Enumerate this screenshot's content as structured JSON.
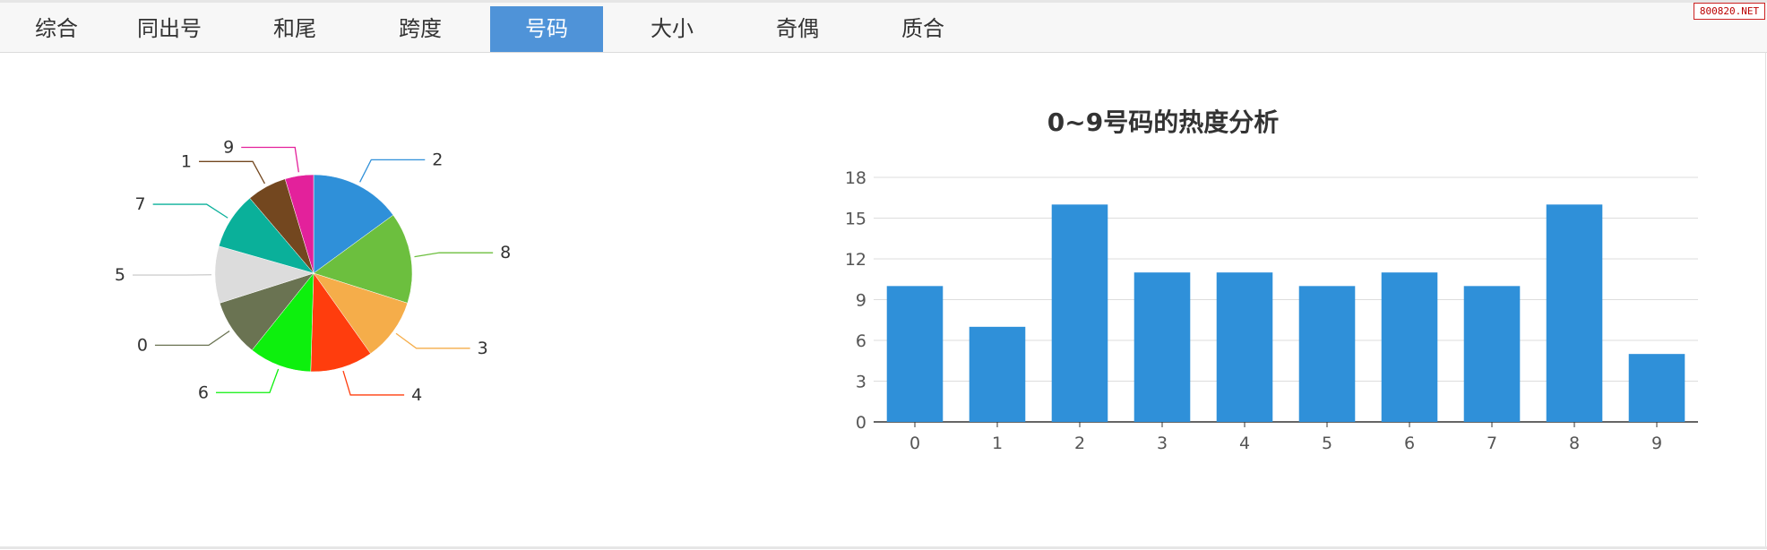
{
  "tabs": [
    {
      "label": "综合",
      "active": false
    },
    {
      "label": "同出号",
      "active": false
    },
    {
      "label": "和尾",
      "active": false
    },
    {
      "label": "跨度",
      "active": false
    },
    {
      "label": "号码",
      "active": true
    },
    {
      "label": "大小",
      "active": false
    },
    {
      "label": "奇偶",
      "active": false
    },
    {
      "label": "质合",
      "active": false
    }
  ],
  "watermark": "800820.NET",
  "chart_data": [
    {
      "type": "pie",
      "title": "",
      "categories": [
        "2",
        "8",
        "3",
        "4",
        "6",
        "0",
        "5",
        "7",
        "1",
        "9"
      ],
      "values": [
        16,
        16,
        11,
        11,
        11,
        10,
        10,
        10,
        7,
        5
      ],
      "colors": [
        "#2f90d9",
        "#6cbf3e",
        "#f5ad4a",
        "#ff3d0d",
        "#0df00d",
        "#6a7352",
        "#dcdcdc",
        "#0ab09a",
        "#73471f",
        "#e3219b"
      ],
      "legend": "none",
      "labels": "outside with leader lines"
    },
    {
      "type": "bar",
      "title": "0~9号码的热度分析",
      "categories": [
        "0",
        "1",
        "2",
        "3",
        "4",
        "5",
        "6",
        "7",
        "8",
        "9"
      ],
      "values": [
        10,
        7,
        16,
        11,
        11,
        10,
        11,
        10,
        16,
        5
      ],
      "ylim": [
        0,
        18
      ],
      "yticks": [
        0,
        3,
        6,
        9,
        12,
        15,
        18
      ],
      "xlabel": "",
      "ylabel": "",
      "grid": true,
      "color": "#2f90d9"
    }
  ]
}
